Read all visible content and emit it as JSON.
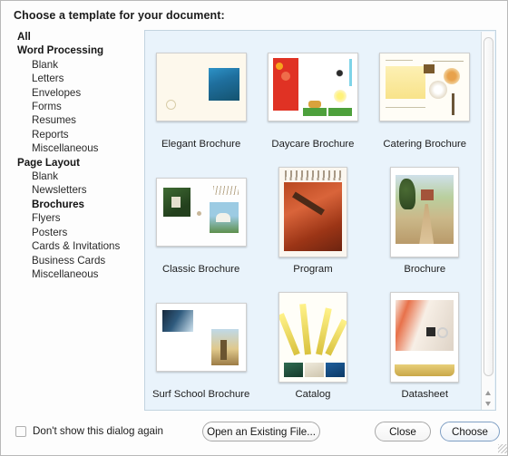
{
  "dialog": {
    "title": "Choose a template for your document:"
  },
  "sidebar": {
    "items": [
      {
        "label": "All",
        "type": "category",
        "selected": false
      },
      {
        "label": "Word Processing",
        "type": "category",
        "selected": false
      },
      {
        "label": "Blank",
        "type": "sub",
        "selected": false
      },
      {
        "label": "Letters",
        "type": "sub",
        "selected": false
      },
      {
        "label": "Envelopes",
        "type": "sub",
        "selected": false
      },
      {
        "label": "Forms",
        "type": "sub",
        "selected": false
      },
      {
        "label": "Resumes",
        "type": "sub",
        "selected": false
      },
      {
        "label": "Reports",
        "type": "sub",
        "selected": false
      },
      {
        "label": "Miscellaneous",
        "type": "sub",
        "selected": false
      },
      {
        "label": "Page Layout",
        "type": "category",
        "selected": false
      },
      {
        "label": "Blank",
        "type": "sub",
        "selected": false
      },
      {
        "label": "Newsletters",
        "type": "sub",
        "selected": false
      },
      {
        "label": "Brochures",
        "type": "sub",
        "selected": true
      },
      {
        "label": "Flyers",
        "type": "sub",
        "selected": false
      },
      {
        "label": "Posters",
        "type": "sub",
        "selected": false
      },
      {
        "label": "Cards & Invitations",
        "type": "sub",
        "selected": false
      },
      {
        "label": "Business Cards",
        "type": "sub",
        "selected": false
      },
      {
        "label": "Miscellaneous",
        "type": "sub",
        "selected": false
      }
    ]
  },
  "templates": [
    {
      "name": "Elegant Brochure",
      "orientation": "landscape"
    },
    {
      "name": "Daycare Brochure",
      "orientation": "landscape"
    },
    {
      "name": "Catering Brochure",
      "orientation": "landscape"
    },
    {
      "name": "Classic Brochure",
      "orientation": "landscape"
    },
    {
      "name": "Program",
      "orientation": "portrait"
    },
    {
      "name": "Brochure",
      "orientation": "portrait"
    },
    {
      "name": "Surf School Brochure",
      "orientation": "landscape"
    },
    {
      "name": "Catalog",
      "orientation": "portrait"
    },
    {
      "name": "Datasheet",
      "orientation": "portrait"
    }
  ],
  "footer": {
    "checkbox_label": "Don't show this dialog again",
    "checkbox_checked": false,
    "open_existing_label": "Open an Existing File...",
    "close_label": "Close",
    "choose_label": "Choose"
  },
  "colors": {
    "panel_background": "#e9f3fb",
    "dialog_background": "#fdfdfd",
    "default_button_border": "#7f9fc4"
  }
}
